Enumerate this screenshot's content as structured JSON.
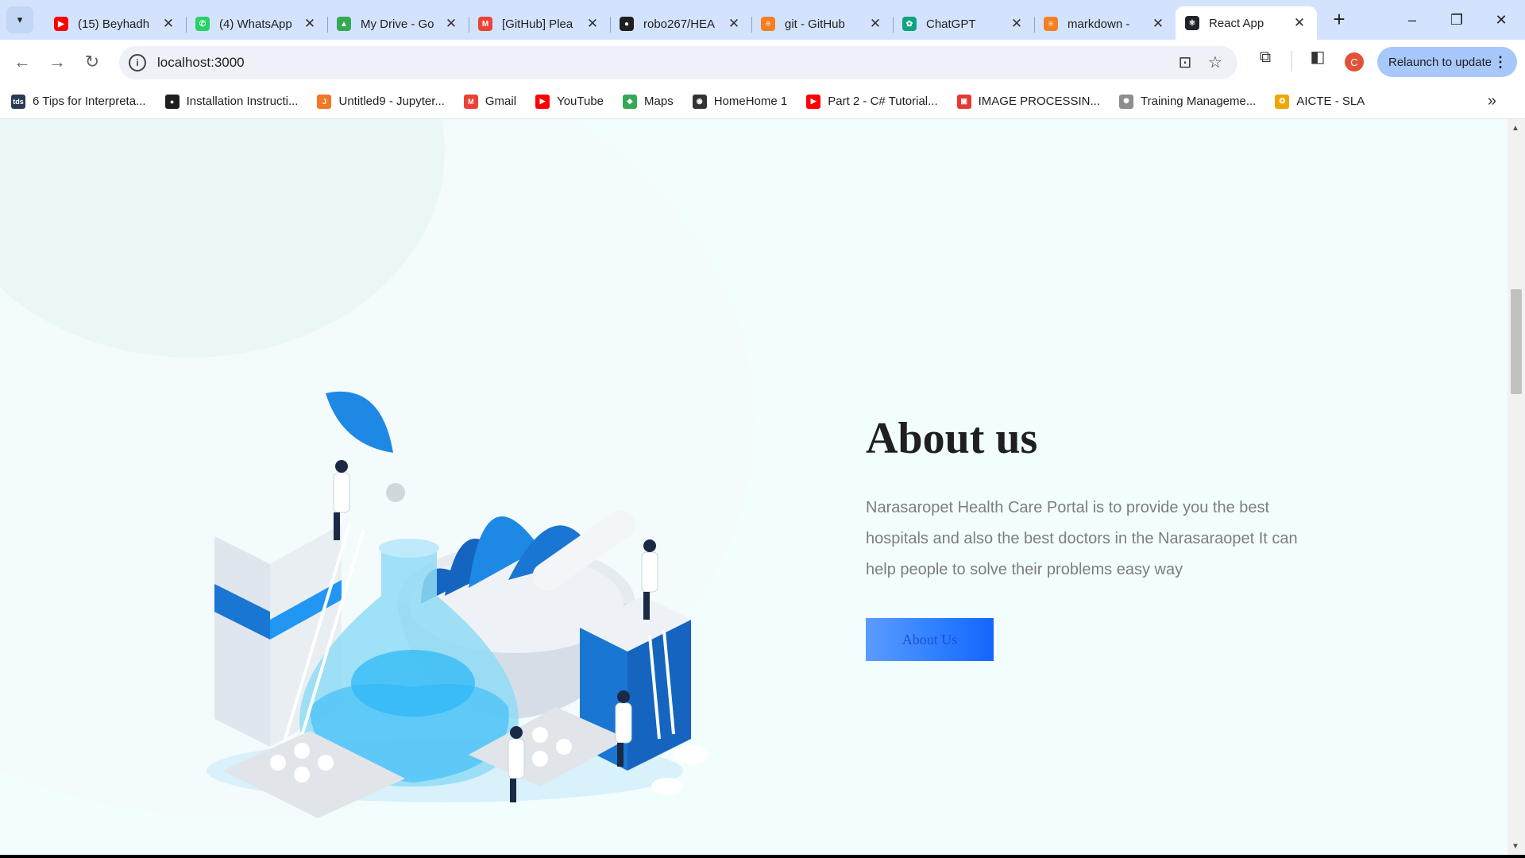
{
  "browser": {
    "tabs": [
      {
        "title": "(15) Beyhadh",
        "favicon": "youtube-icon",
        "color": "#ff0000",
        "glyph": "▶"
      },
      {
        "title": "(4) WhatsApp",
        "favicon": "whatsapp-icon",
        "color": "#25d366",
        "glyph": "✆"
      },
      {
        "title": "My Drive - Go",
        "favicon": "google-drive-icon",
        "color": "#34a853",
        "glyph": "▲"
      },
      {
        "title": "[GitHub] Plea",
        "favicon": "gmail-icon",
        "color": "#ea4335",
        "glyph": "M"
      },
      {
        "title": "robo267/HEA",
        "favicon": "github-icon",
        "color": "#1f1f1f",
        "glyph": "●"
      },
      {
        "title": "git - GitHub",
        "favicon": "stackoverflow-icon",
        "color": "#f48024",
        "glyph": "≡"
      },
      {
        "title": "ChatGPT",
        "favicon": "chatgpt-icon",
        "color": "#10a37f",
        "glyph": "✿"
      },
      {
        "title": "markdown -",
        "favicon": "stackoverflow-icon",
        "color": "#f48024",
        "glyph": "≡"
      },
      {
        "title": "React App",
        "favicon": "react-icon",
        "color": "#20232a",
        "glyph": "⚛",
        "active": true
      }
    ],
    "url": "localhost:3000",
    "profile_initial": "C",
    "relaunch_label": "Relaunch to update",
    "bookmarks": [
      {
        "label": "6 Tips for Interpreta...",
        "icon": "tds-icon",
        "color": "#2b3a55",
        "glyph": "tds"
      },
      {
        "label": "Installation Instructi...",
        "icon": "github-icon",
        "color": "#1f1f1f",
        "glyph": "●"
      },
      {
        "label": "Untitled9 - Jupyter...",
        "icon": "jupyter-icon",
        "color": "#f37726",
        "glyph": "J"
      },
      {
        "label": "Gmail",
        "icon": "gmail-icon",
        "color": "#ea4335",
        "glyph": "M"
      },
      {
        "label": "YouTube",
        "icon": "youtube-icon",
        "color": "#ff0000",
        "glyph": "▶"
      },
      {
        "label": "Maps",
        "icon": "maps-icon",
        "color": "#34a853",
        "glyph": "◆"
      },
      {
        "label": "HomeHome 1",
        "icon": "globe-icon",
        "color": "#333333",
        "glyph": "◉"
      },
      {
        "label": "Part 2 - C# Tutorial...",
        "icon": "youtube-icon",
        "color": "#ff0000",
        "glyph": "▶"
      },
      {
        "label": "IMAGE PROCESSIN...",
        "icon": "image-doc-icon",
        "color": "#e53935",
        "glyph": "▣"
      },
      {
        "label": "Training Manageme...",
        "icon": "training-icon",
        "color": "#8d8d8d",
        "glyph": "✺"
      },
      {
        "label": "AICTE - SLA",
        "icon": "aicte-icon",
        "color": "#f0a500",
        "glyph": "✪"
      }
    ]
  },
  "page": {
    "about": {
      "title": "About us",
      "text": "Narasaropet Health Care Portal is to provide you the best hospitals and also the best doctors in the Narasaraopet It can help people to solve their problems easy way",
      "button_label": "About Us"
    }
  },
  "colors": {
    "page_background": "#f2fefe",
    "accent": "#2f80ff",
    "tab_strip": "#d3e3fd"
  }
}
